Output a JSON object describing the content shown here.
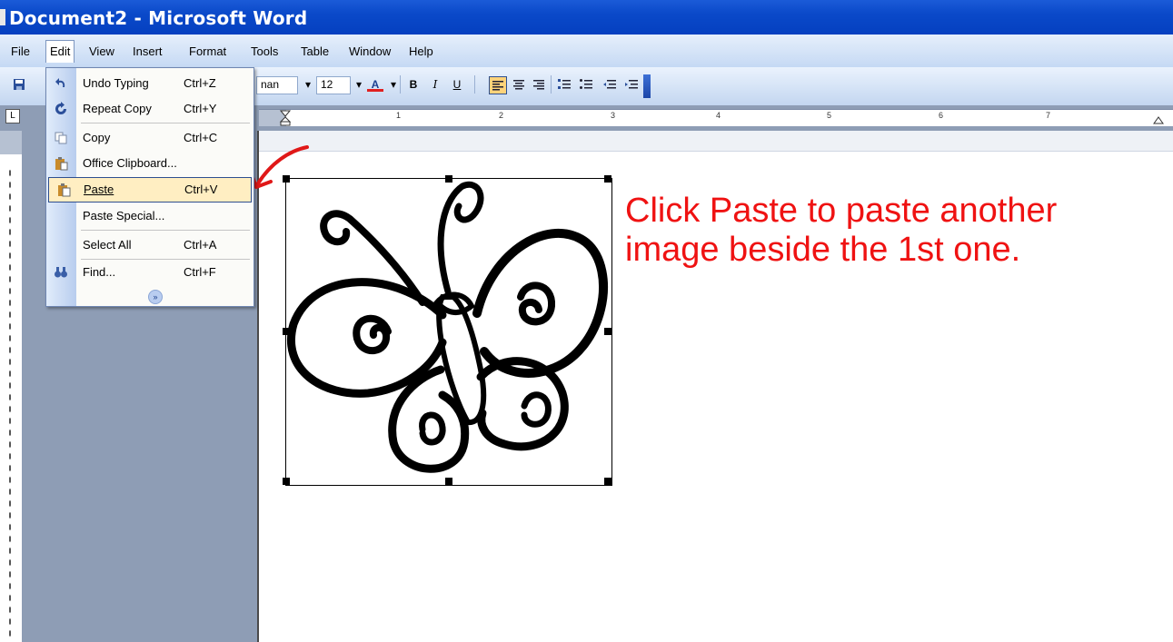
{
  "window": {
    "title": "Document2 - Microsoft Word"
  },
  "menubar": {
    "items": [
      {
        "label": "File"
      },
      {
        "label": "Edit"
      },
      {
        "label": "View"
      },
      {
        "label": "Insert"
      },
      {
        "label": "Format"
      },
      {
        "label": "Tools"
      },
      {
        "label": "Table"
      },
      {
        "label": "Window"
      },
      {
        "label": "Help"
      }
    ]
  },
  "toolbar": {
    "font_name_fragment": "nan",
    "font_size": "12",
    "bold": "B",
    "italic": "I",
    "underline": "U"
  },
  "ruler": {
    "numbers": [
      "1",
      "2",
      "3",
      "4",
      "5",
      "6",
      "7"
    ]
  },
  "edit_menu": {
    "items": [
      {
        "label": "Undo Typing",
        "shortcut": "Ctrl+Z",
        "icon": "undo-icon"
      },
      {
        "label": "Repeat Copy",
        "shortcut": "Ctrl+Y",
        "icon": "repeat-icon"
      },
      {
        "label": "Copy",
        "shortcut": "Ctrl+C",
        "icon": "copy-icon"
      },
      {
        "label": "Office Clipboard...",
        "shortcut": "",
        "icon": "clipboard-icon"
      },
      {
        "label": "Paste",
        "shortcut": "Ctrl+V",
        "icon": "paste-icon",
        "highlighted": true
      },
      {
        "label": "Paste Special...",
        "shortcut": ""
      },
      {
        "label": "Select All",
        "shortcut": "Ctrl+A"
      },
      {
        "label": "Find...",
        "shortcut": "Ctrl+F",
        "icon": "binoculars-icon"
      }
    ],
    "expand_icon": "double-chevron-down-icon"
  },
  "document": {
    "annotation_line1": "Click Paste to paste another",
    "annotation_line2": "image beside the 1st one.",
    "annotation_color": "#ef1212",
    "image": "butterfly line-art image (selected)"
  },
  "colors": {
    "titlebar": "#0a49c9",
    "menu_highlight": "#ffeec2",
    "gutter": "#8e9db5"
  }
}
